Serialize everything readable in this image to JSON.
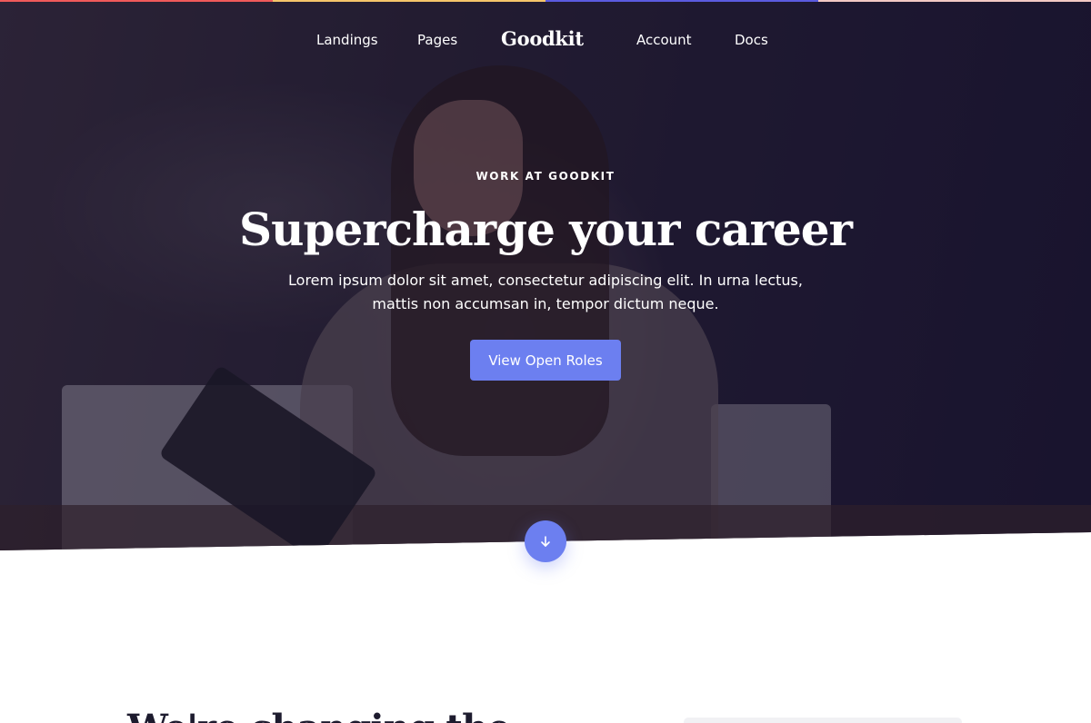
{
  "top_bar": {
    "colors": [
      "#f05a5a",
      "#f5c56a",
      "#5b5be0",
      "#f3c9c4"
    ]
  },
  "nav": {
    "items": [
      {
        "label": "Landings"
      },
      {
        "label": "Pages"
      },
      {
        "label": "Account"
      },
      {
        "label": "Docs"
      }
    ],
    "brand": "Goodkit"
  },
  "hero": {
    "eyebrow": "WORK AT GOODKIT",
    "headline": "Supercharge your career",
    "lede": "Lorem ipsum dolor sit amet, consectetur adipiscing elit. In urna lectus, mattis non accumsan in, tempor dictum neque.",
    "cta_label": "View Open Roles",
    "scroll_icon": "arrow-down-icon"
  },
  "section": {
    "title": "We're changing the"
  },
  "colors": {
    "accent": "#6c7ff0",
    "text_dark": "#1d1b2e"
  }
}
